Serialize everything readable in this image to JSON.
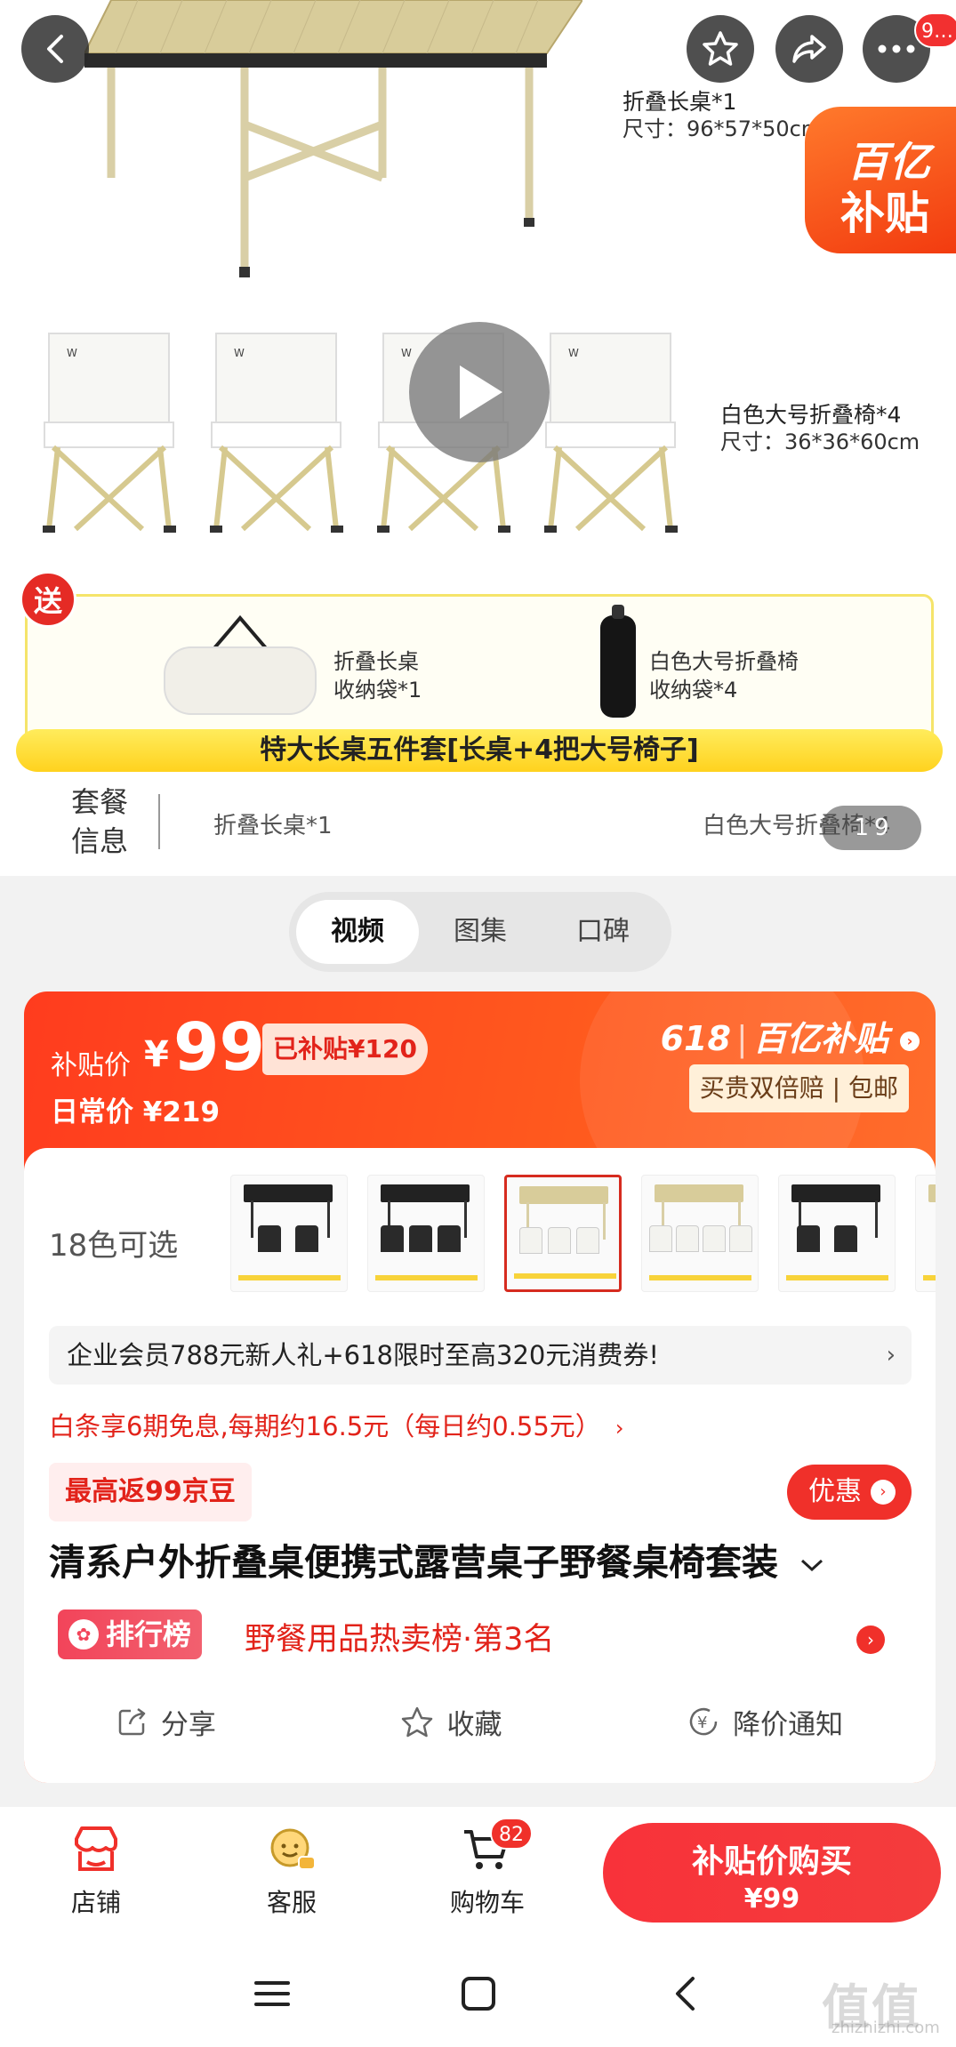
{
  "top_bar": {
    "more_badge": "9…",
    "icons": [
      "back-icon",
      "star-icon",
      "share-icon",
      "more-icon"
    ]
  },
  "hero": {
    "table_label": "折叠长桌*1",
    "table_size": "尺寸：96*57*50cm",
    "chair_label": "白色大号折叠椅*4",
    "chair_size": "尺寸：36*36*60cm",
    "subsidy_badge_line1": "百亿",
    "subsidy_badge_line2": "补贴",
    "gift_tag": "送",
    "gift_1_line1": "折叠长桌",
    "gift_1_line2": "收纳袋*1",
    "gift_2_line1": "白色大号折叠椅",
    "gift_2_line2": "收纳袋*4",
    "bundle_title": "特大长桌五件套[长桌+4把大号椅子]",
    "package_title_1": "套餐",
    "package_title_2": "信息",
    "package_item_1": "折叠长桌*1",
    "package_item_2": "白色大号折叠椅*4",
    "page_current": "1",
    "page_total": "9"
  },
  "media_tabs": [
    "视频",
    "图集",
    "口碑"
  ],
  "price": {
    "subsidy_label": "补贴价",
    "currency": "¥",
    "subsidy_price": "99",
    "saved": "已补贴¥120",
    "daily_price": "日常价 ¥219",
    "promo_618": "618",
    "promo_brand": "百亿补贴",
    "guarantee": "买贵双倍赔 | 包邮"
  },
  "colors_label": "18色可选",
  "coupon": "企业会员788元新人礼+618限时至高320元消费券!",
  "installment": "白条享6期免息,每期约16.5元（每日约0.55元）",
  "bean_badge": "最高返99京豆",
  "discount_btn": "优惠",
  "product_title": "清系户外折叠桌便携式露营桌子野餐桌椅套装",
  "rank_badge": "排行榜",
  "rank_text": "野餐用品热卖榜·第3名",
  "actions": [
    "分享",
    "收藏",
    "降价通知"
  ],
  "bottom_bar": {
    "store": "店铺",
    "service": "客服",
    "cart": "购物车",
    "cart_count": "82",
    "buy_line1": "补贴价购买",
    "buy_line2": "¥99"
  },
  "watermark": "值值值",
  "watermark_sub": "zhizhizhi.com",
  "colors": {
    "accent_red": "#f0302a",
    "subsidy_orange": "#ff5a1e",
    "gift_yellow": "#ffd21e"
  }
}
